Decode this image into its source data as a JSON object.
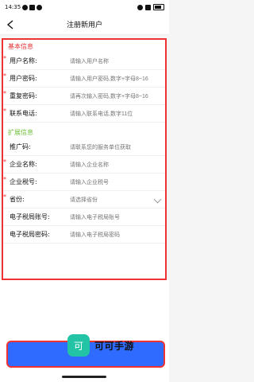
{
  "status_bar": {
    "time": "14:35"
  },
  "header": {
    "title": "注册新用户"
  },
  "sections": [
    {
      "title": "基本信息",
      "color": "#e33333",
      "fields": [
        {
          "label": "用户名称:",
          "placeholder": "请输入用户名称",
          "required": true
        },
        {
          "label": "用户密码:",
          "placeholder": "请输入用户密码,数字+字母8~16",
          "required": true
        },
        {
          "label": "重复密码:",
          "placeholder": "请再次输入密码,数字+字母8~16",
          "required": true
        },
        {
          "label": "联系电话:",
          "placeholder": "请输入联系电话,数字11位",
          "required": true
        }
      ]
    },
    {
      "title": "扩展信息",
      "color": "#6fbf3b",
      "fields": [
        {
          "label": "推广码:",
          "placeholder": "请联系您的服务单位获取",
          "required": false
        },
        {
          "label": "企业名称:",
          "placeholder": "请输入企业名称",
          "required": true
        },
        {
          "label": "企业税号:",
          "placeholder": "请输入企业税号",
          "required": true
        },
        {
          "label": "省份:",
          "placeholder": "请选择省份",
          "required": true,
          "type": "select"
        },
        {
          "label": "电子税局账号:",
          "placeholder": "请输入电子税局账号",
          "required": false
        },
        {
          "label": "电子税局密码:",
          "placeholder": "请输入电子税局密码",
          "required": false
        }
      ]
    }
  ],
  "watermark": {
    "logo_text": "可",
    "brand": "可可手游"
  }
}
